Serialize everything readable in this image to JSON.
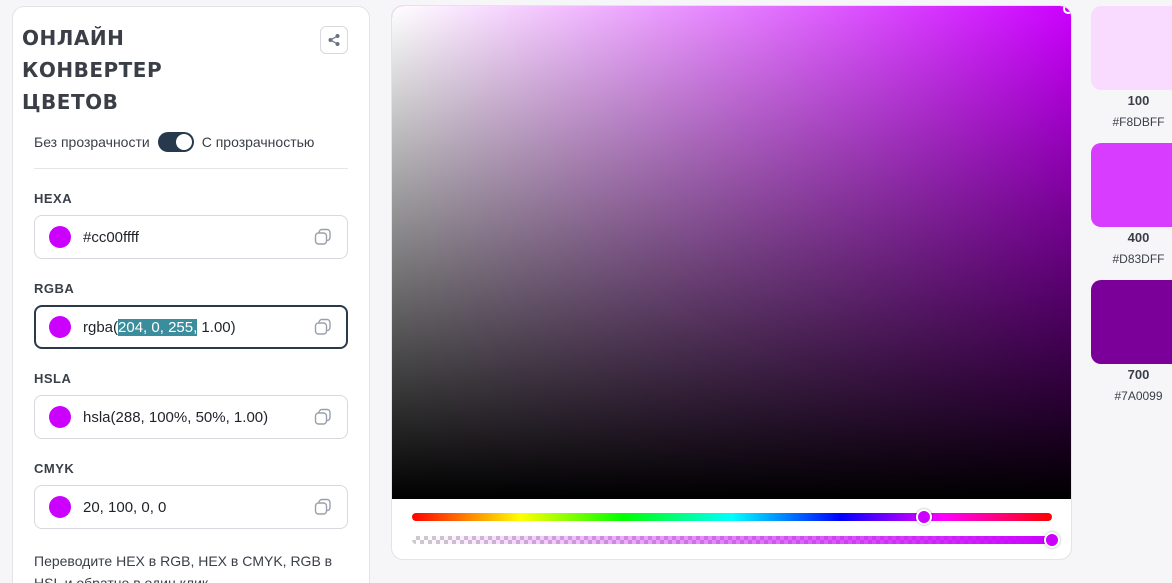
{
  "header": {
    "title_line1": "ОНЛАЙН",
    "title_line2": "КОНВЕРТЕР",
    "title_line3": "ЦВЕТОВ"
  },
  "toggle": {
    "left_label": "Без прозрачности",
    "right_label": "С прозрачностью",
    "state": "on"
  },
  "fields": [
    {
      "label": "HEXA",
      "value": "#cc00ffff"
    },
    {
      "label": "RGBA",
      "value_prefix": "rgba(",
      "value_selected": "204, 0, 255,",
      "value_suffix": " 1.00)"
    },
    {
      "label": "HSLA",
      "value": "hsla(288, 100%, 50%, 1.00)"
    },
    {
      "label": "CMYK",
      "value": "20, 100, 0, 0"
    }
  ],
  "description": "Переводите HEX в RGB, HEX в CMYK, RGB в HSL и обратно в один клик.",
  "current_color": "#cc00ff",
  "hue_position_fraction": 0.8,
  "alpha_value": 1.0,
  "shades": [
    {
      "level": "100",
      "hex": "#F8DBFF",
      "color": "#f8dbff"
    },
    {
      "level": "400",
      "hex": "#D83DFF",
      "color": "#d83dff"
    },
    {
      "level": "700",
      "hex": "#7A0099",
      "color": "#7a0099"
    }
  ],
  "icons": {
    "share": "share-icon",
    "copy": "copy-icon"
  }
}
